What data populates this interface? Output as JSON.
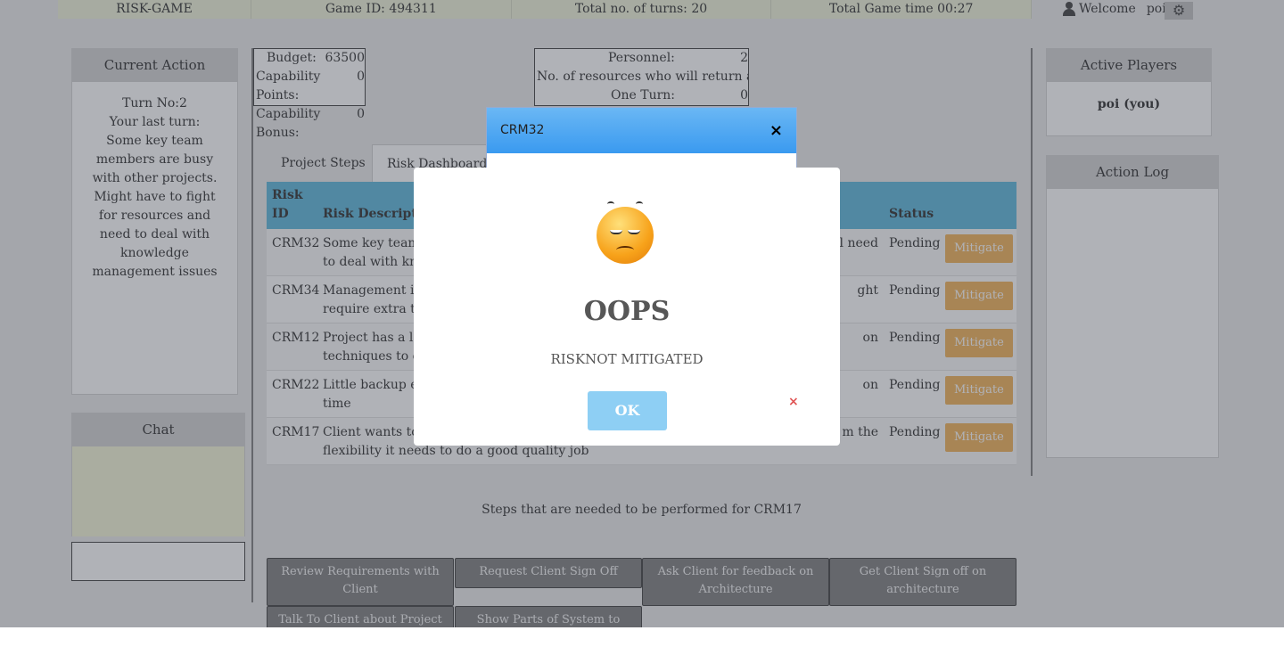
{
  "topbar": {
    "game_name": "RISK-GAME",
    "game_id": "Game ID: 494311",
    "total_turns": "Total no. of turns: 20",
    "game_time": "Total Game time 00:27",
    "welcome": "Welcome",
    "username": "poi!"
  },
  "current_action": {
    "title": "Current Action",
    "turn": "Turn No:2",
    "last_turn_label": "Your last turn:",
    "text": "Some key team members are busy with other projects. Might have to fight for resources and need to deal with knowledge management issues"
  },
  "chat": {
    "title": "Chat"
  },
  "active_players": {
    "title": "Active Players",
    "player": "poi (you)"
  },
  "action_log": {
    "title": "Action Log"
  },
  "budget": {
    "budget_label": "Budget:",
    "budget_value": "63500",
    "cap_points_label": "Capability Points:",
    "cap_points_value": "0",
    "cap_bonus_label": "Capability Bonus:",
    "cap_bonus_value": "0"
  },
  "personnel": {
    "label": "Personnel:",
    "value": "2",
    "return_label": "No. of resources who will return after",
    "one_turn_label": "One Turn:",
    "one_turn_value": "0"
  },
  "tabs": {
    "steps": "Project Steps",
    "dashboard": "Risk Dashboard"
  },
  "table": {
    "headers": {
      "id": "Risk ID",
      "desc": "Risk Descriptio",
      "status": "Status"
    },
    "rows": [
      {
        "id": "CRM32",
        "desc1": "Some key team m",
        "desc1_end": "l need",
        "desc2": "to deal with kno",
        "status": "Pending",
        "action": "Mitigate"
      },
      {
        "id": "CRM34",
        "desc1": "Management is i",
        "desc1_end": "ght",
        "desc2": "require extra tim",
        "status": "Pending",
        "action": "Mitigate"
      },
      {
        "id": "CRM12",
        "desc1": "Project has a lot",
        "desc1_end": "on",
        "desc2": "techniques to co",
        "status": "Pending",
        "action": "Mitigate"
      },
      {
        "id": "CRM22",
        "desc1": "Little backup ex",
        "desc1_end": "on",
        "desc2": "time",
        "status": "Pending",
        "action": "Mitigate"
      },
      {
        "id": "CRM17",
        "desc1": "Client wants to b",
        "desc1_end": "m the",
        "desc2": "flexibility it needs to do a good quality job",
        "status": "Pending",
        "action": "Mitigate"
      }
    ]
  },
  "steps": {
    "title": "Steps that are needed to be performed for CRM17",
    "buttons": [
      "Review Requirements with Client",
      "Request Client Sign Off",
      "Ask Client for feedback on Architecture",
      "Get Client Sign off on architecture",
      "Talk To Client about Project",
      "Show Parts of System to Client"
    ]
  },
  "crm_dialog": {
    "title": "CRM32",
    "close": "×"
  },
  "oops_dialog": {
    "title": "OOPS",
    "message": "RISKNOT MITIGATED",
    "ok": "OK",
    "close": "×"
  },
  "colors": {
    "header_blue": "#52b3d9",
    "mitigate": "#f0ad4e",
    "ok_button": "#8ecff4"
  }
}
